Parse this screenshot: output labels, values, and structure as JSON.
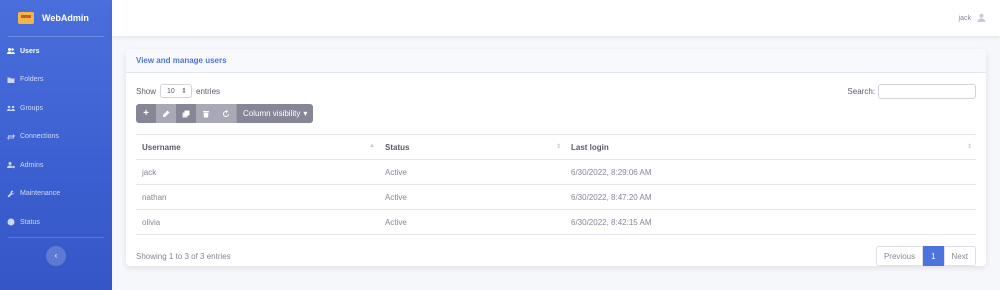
{
  "brand": {
    "name": "WebAdmin"
  },
  "sidebar": {
    "items": [
      {
        "label": "Users",
        "icon": "users-icon",
        "active": true
      },
      {
        "label": "Folders",
        "icon": "folder-icon",
        "active": false
      },
      {
        "label": "Groups",
        "icon": "groups-icon",
        "active": false
      },
      {
        "label": "Connections",
        "icon": "exchange-icon",
        "active": false
      },
      {
        "label": "Admins",
        "icon": "user-cog-icon",
        "active": false
      },
      {
        "label": "Maintenance",
        "icon": "wrench-icon",
        "active": false
      },
      {
        "label": "Status",
        "icon": "info-circle-icon",
        "active": false
      }
    ],
    "toggle_glyph": "‹"
  },
  "topbar": {
    "user_name": "jack"
  },
  "card": {
    "title": "View and manage users"
  },
  "table_controls": {
    "show_label": "Show",
    "entries_label": "entries",
    "length_value": "10",
    "search_label": "Search:",
    "search_value": "",
    "colvis_label": "Column visibility"
  },
  "table": {
    "columns": [
      "Username",
      "Status",
      "Last login"
    ],
    "rows": [
      [
        "jack",
        "Active",
        "6/30/2022, 8:29:06 AM"
      ],
      [
        "nathan",
        "Active",
        "6/30/2022, 8:47:20 AM"
      ],
      [
        "olivia",
        "Active",
        "6/30/2022, 8:42:15 AM"
      ]
    ]
  },
  "footer": {
    "info": "Showing 1 to 3 of 3 entries",
    "prev_label": "Previous",
    "page_label": "1",
    "next_label": "Next"
  },
  "colors": {
    "accent": "#4e73df",
    "sidebar": "#4a6fdc",
    "toolbar": "#858796"
  }
}
